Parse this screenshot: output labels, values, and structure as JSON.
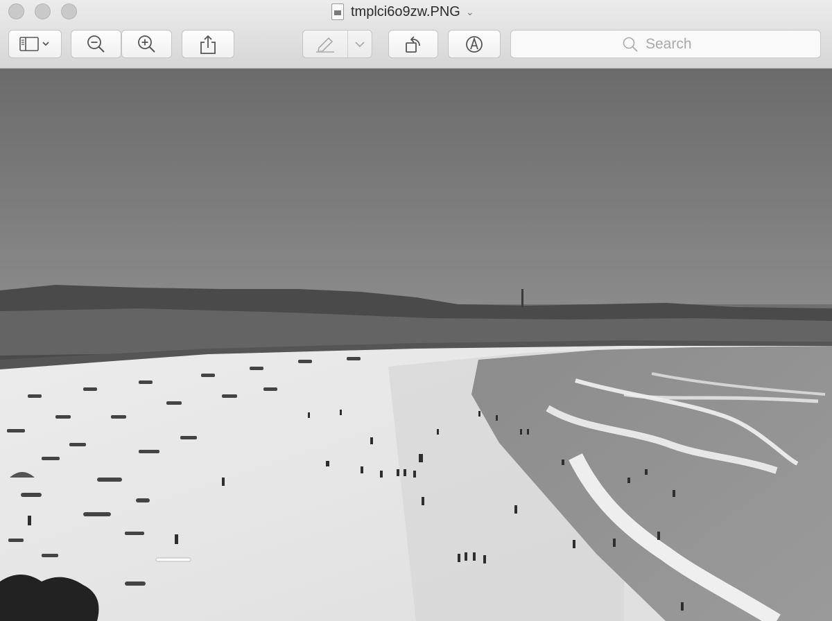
{
  "window": {
    "title": "tmplci6o9zw.PNG",
    "traffic_lights": [
      "close-button",
      "minimize-button",
      "zoom-button"
    ]
  },
  "toolbar": {
    "buttons": [
      {
        "name": "sidebar-toggle-button",
        "icon": "sidebar-icon"
      },
      {
        "name": "zoom-out-button",
        "icon": "zoom-out-icon"
      },
      {
        "name": "zoom-in-button",
        "icon": "zoom-in-icon"
      },
      {
        "name": "share-button",
        "icon": "share-icon"
      },
      {
        "name": "highlight-button",
        "icon": "highlighter-icon"
      },
      {
        "name": "rotate-button",
        "icon": "rotate-left-icon"
      },
      {
        "name": "markup-button",
        "icon": "markup-pen-icon"
      }
    ],
    "search": {
      "placeholder": "Search",
      "value": ""
    }
  },
  "image": {
    "description_kind": "grayscale photo",
    "colors": {
      "sky": "#707070",
      "sand": "#e8e8e8",
      "sea": "#9a9a9a"
    }
  }
}
